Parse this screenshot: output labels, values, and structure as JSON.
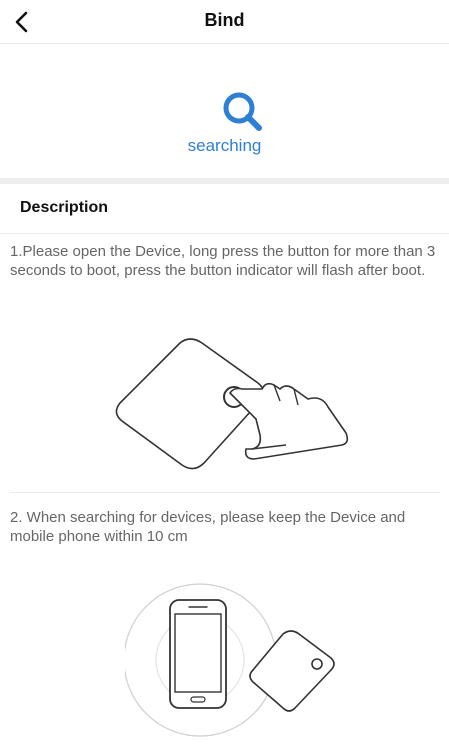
{
  "header": {
    "title": "Bind",
    "back_icon": "chevron-left-icon"
  },
  "search": {
    "icon": "search-icon",
    "status": "searching",
    "accent_color": "#2f7fd4"
  },
  "description": {
    "title": "Description",
    "steps": [
      {
        "text": "1.Please open the Device, long press the button for more than 3 seconds to boot, press the button indicator will flash after boot.",
        "illustration": "finger-press-device-illustration"
      },
      {
        "text": "2. When searching for devices, please keep the Device and mobile phone within 10 cm",
        "illustration": "phone-near-device-illustration"
      }
    ]
  }
}
